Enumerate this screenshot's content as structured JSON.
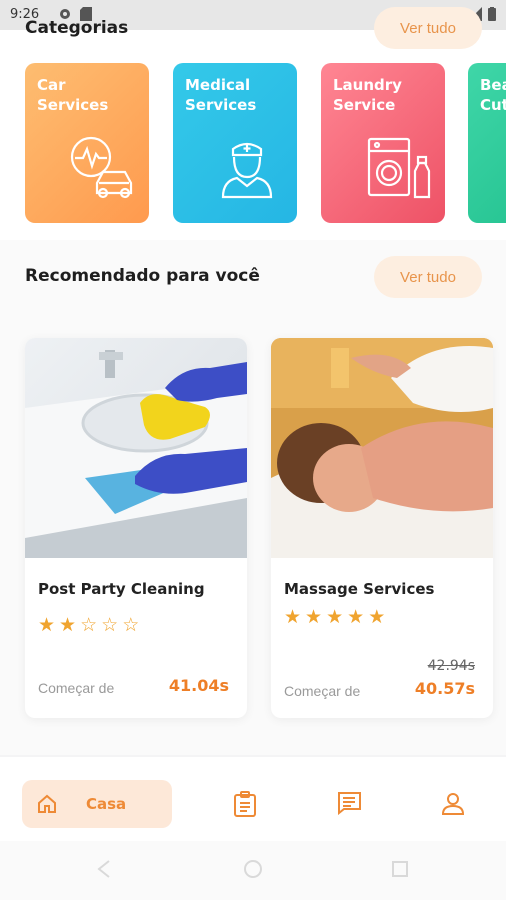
{
  "status_bar": {
    "time": "9:26"
  },
  "categories": {
    "title": "Categorias",
    "see_all": "Ver tudo",
    "items": [
      {
        "label": "Car Services",
        "icon": "car-service-icon",
        "gradient": [
          "#fdbd71",
          "#ff9a4e"
        ]
      },
      {
        "label": "Medical\nServices",
        "icon": "nurse-icon",
        "gradient": [
          "#34c9e9",
          "#25b6e4"
        ]
      },
      {
        "label": "Laundry\nService",
        "icon": "washing-machine-icon",
        "gradient": [
          "#ff8693",
          "#ee5266"
        ]
      },
      {
        "label": "Beauty\nCut",
        "icon": "beauty-icon",
        "gradient": [
          "#3fd6a8",
          "#1fbf8c"
        ]
      }
    ]
  },
  "recommended": {
    "title": "Recomendado para você",
    "see_all": "Ver tudo",
    "services": [
      {
        "name": "Post Party Cleaning",
        "rating": 2,
        "max_rating": 5,
        "start_label": "Começar de",
        "price": "41.04s",
        "old_price": ""
      },
      {
        "name": "Massage Services",
        "rating": 5,
        "max_rating": 5,
        "start_label": "Começar de",
        "price": "40.57s",
        "old_price": "42.94s"
      }
    ]
  },
  "bottom_nav": {
    "home_label": "Casa",
    "items": [
      "home-icon",
      "orders-icon",
      "chat-icon",
      "profile-icon"
    ],
    "accent": "#ee8a36"
  }
}
